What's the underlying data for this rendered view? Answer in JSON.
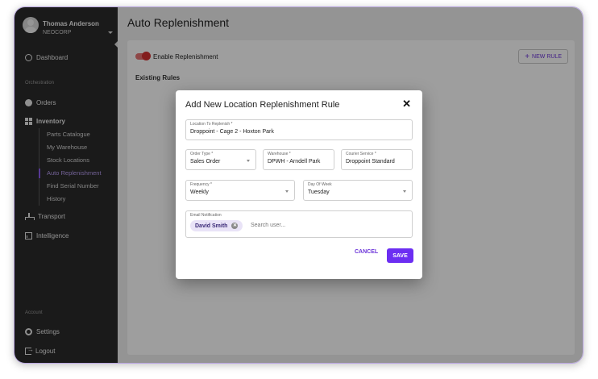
{
  "user": {
    "name": "Thomas Anderson",
    "org": "NEOCORP"
  },
  "sidebar": {
    "dashboard": "Dashboard",
    "section_orchestration": "Orchestration",
    "orders": "Orders",
    "inventory": "Inventory",
    "inventory_items": [
      "Parts Catalogue",
      "My Warehouse",
      "Stock Locations",
      "Auto Replenishment",
      "Find Serial Number",
      "History"
    ],
    "active_item": "Auto Replenishment",
    "transport": "Transport",
    "intelligence": "Intelligence",
    "section_account": "Account",
    "settings": "Settings",
    "logout": "Logout"
  },
  "main": {
    "title": "Auto Replenishment",
    "toggle_label": "Enable Replenishment",
    "new_rule_label": "NEW RULE",
    "existing_rules": "Existing Rules"
  },
  "dialog": {
    "title": "Add New Location Replenishment Rule",
    "location": {
      "label": "Location To Replenish *",
      "value": "Droppoint - Cage 2 - Hoxton Park"
    },
    "order_type": {
      "label": "Order Type *",
      "value": "Sales Order"
    },
    "warehouse": {
      "label": "Warehouse *",
      "value": "DPWH - Arndell Park"
    },
    "courier": {
      "label": "Courier Service *",
      "value": "Droppoint Standard"
    },
    "frequency": {
      "label": "Frequency *",
      "value": "Weekly"
    },
    "day_of_week": {
      "label": "Day Of Week",
      "value": "Tuesday"
    },
    "email": {
      "label": "Email Notification",
      "chip": "David Smith",
      "placeholder": "Search user..."
    },
    "cancel_label": "CANCEL",
    "save_label": "SAVE"
  },
  "colors": {
    "accent": "#6c2ef2",
    "toggle": "#d32f2f",
    "sidebar": "#2b2b2b"
  }
}
